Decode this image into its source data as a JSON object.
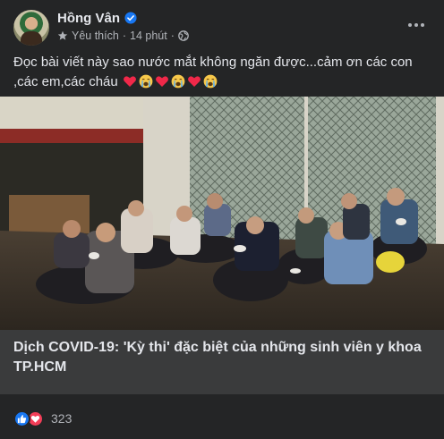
{
  "post": {
    "author": "Hồng Vân",
    "favorite_label": "Yêu thích",
    "separator": "·",
    "time": "14 phút",
    "caption_text": "Đọc bài viết này sao nước mắt không ngăn được...cảm ơn các con ,các em,các cháu",
    "caption_emojis": [
      "heart",
      "crying-face",
      "heart",
      "crying-face",
      "heart",
      "crying-face"
    ]
  },
  "link_preview": {
    "title": "Dịch COVID-19: 'Kỳ thi' đặc biệt của những sinh viên y khoa TP.HCM"
  },
  "reactions": {
    "types": [
      "like",
      "love"
    ],
    "count": "323"
  },
  "colors": {
    "background": "#242526",
    "text_primary": "#e4e6eb",
    "text_secondary": "#b0b3b8",
    "like_blue": "#1877f2",
    "love_red": "#f33e58",
    "link_box": "#3a3b3c"
  }
}
